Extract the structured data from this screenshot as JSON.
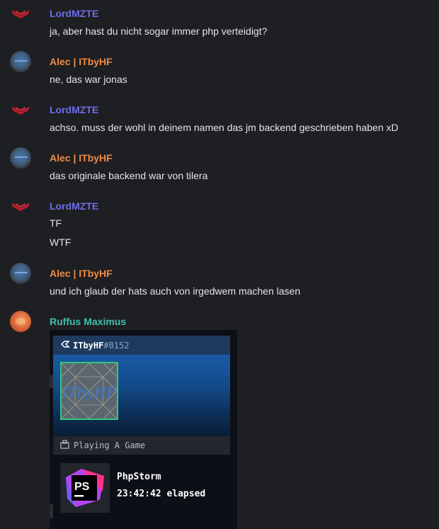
{
  "messages": [
    {
      "author": "LordMZTE",
      "text": [
        "ja, aber hast du nicht sogar immer php verteidigt?"
      ]
    },
    {
      "author": "Alec | ITbyHF",
      "text": [
        "ne, das war jonas"
      ]
    },
    {
      "author": "LordMZTE",
      "text": [
        "achso. muss der wohl in deinem namen das jm backend geschrieben haben xD"
      ]
    },
    {
      "author": "Alec | ITbyHF",
      "text": [
        "das originale backend war von tilera"
      ]
    },
    {
      "author": "LordMZTE",
      "text": [
        "TF",
        "WTF"
      ]
    },
    {
      "author": "Alec | ITbyHF",
      "text": [
        "und ich glaub der hats auch von irgedwem machen lasen"
      ]
    },
    {
      "author": "Ruffus Maximus",
      "text": []
    }
  ],
  "card": {
    "username": "ITbyHF",
    "discriminator": "#0152",
    "avatar_text": "ITbyHF",
    "playing_label": "Playing A Game",
    "app_name": "PhpStorm",
    "app_icon_text": "PS",
    "elapsed": "23:42:42 elapsed"
  },
  "colors": {
    "lord": "#6d6ee8",
    "alec": "#f28b45",
    "ruffus": "#3ec0b1",
    "background": "#1e1f22"
  },
  "icons": [
    "lordmzte-avatar-icon",
    "alec-avatar",
    "ruffus-avatar",
    "discord-logo-icon",
    "game-controller-icon",
    "phpstorm-icon"
  ]
}
